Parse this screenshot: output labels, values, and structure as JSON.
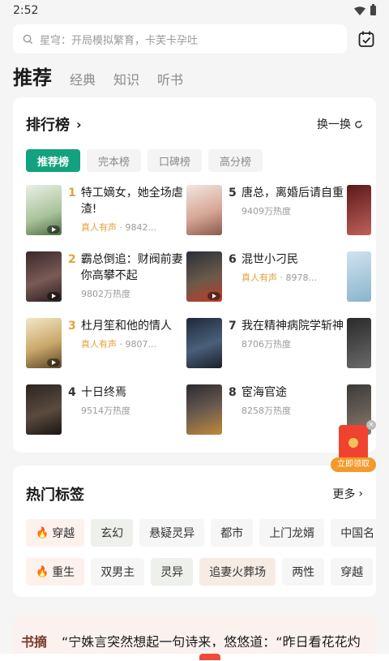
{
  "status": {
    "time": "2:52"
  },
  "search": {
    "placeholder": "星穹：开局模拟繁育，卡芙卡孕吐"
  },
  "tabs": [
    {
      "label": "推荐"
    },
    {
      "label": "经典"
    },
    {
      "label": "知识"
    },
    {
      "label": "听书"
    }
  ],
  "rank": {
    "title": "排行榜",
    "refresh_label": "换一换",
    "sub_tabs": [
      "推荐榜",
      "完本榜",
      "口碑榜",
      "高分榜"
    ],
    "items": [
      {
        "num": "1",
        "title": "特工嫡女，她全场虐渣!",
        "voice": "真人有声",
        "meta": " · 9842..."
      },
      {
        "num": "2",
        "title": "霸总倒追：财阀前妻你高攀不起",
        "voice": "",
        "meta": "9802万热度"
      },
      {
        "num": "3",
        "title": "杜月笙和他的情人",
        "voice": "真人有声",
        "meta": " · 9807..."
      },
      {
        "num": "4",
        "title": "十日终焉",
        "voice": "",
        "meta": "9514万热度"
      },
      {
        "num": "5",
        "title": "唐总，离婚后请自重",
        "voice": "",
        "meta": "9409万热度"
      },
      {
        "num": "6",
        "title": "混世小刁民",
        "voice": "真人有声",
        "meta": " · 8978..."
      },
      {
        "num": "7",
        "title": "我在精神病院学斩神",
        "voice": "",
        "meta": "8706万热度"
      },
      {
        "num": "8",
        "title": "宦海官途",
        "voice": "",
        "meta": "8258万热度"
      }
    ]
  },
  "redpacket": {
    "label": "立即领取"
  },
  "tags": {
    "title": "热门标签",
    "more_label": "更多",
    "row1": [
      "穿越",
      "玄幻",
      "悬疑灵异",
      "都市",
      "上门龙婿",
      "中国名"
    ],
    "row2": [
      "重生",
      "双男主",
      "灵异",
      "追妻火葬场",
      "两性",
      "穿越"
    ]
  },
  "excerpt": {
    "label": "书摘",
    "text": "“宁姝言突然想起一句诗来，悠悠道：“昨日看花花灼"
  },
  "colors": {
    "accent": "#12a27d",
    "voice": "#e4a13b",
    "red": "#f0432f"
  }
}
